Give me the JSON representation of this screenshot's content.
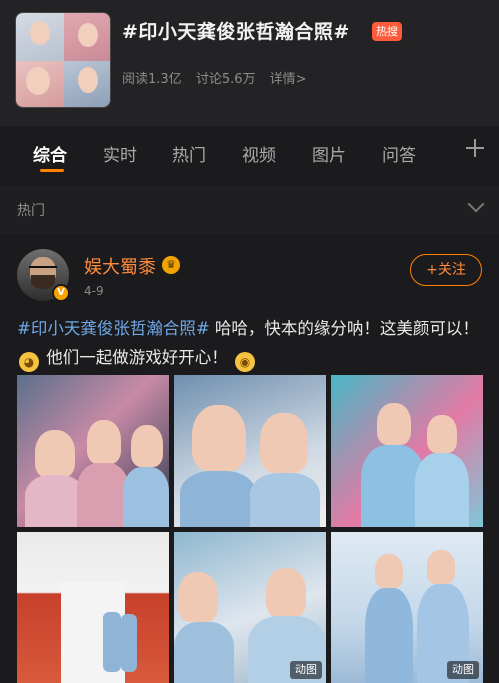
{
  "topic": {
    "title": "#印小天龚俊张哲瀚合照#",
    "badge": "热搜",
    "reads": "阅读1.3亿",
    "discussions": "讨论5.6万",
    "details": "详情>"
  },
  "tabs": [
    {
      "label": "综合",
      "active": true
    },
    {
      "label": "实时",
      "active": false
    },
    {
      "label": "热门",
      "active": false
    },
    {
      "label": "视频",
      "active": false
    },
    {
      "label": "图片",
      "active": false
    },
    {
      "label": "问答",
      "active": false
    }
  ],
  "section": {
    "label": "热门"
  },
  "post": {
    "username": "娱大蜀黍",
    "time": "4-9",
    "follow_label": "+关注",
    "hashtag": "#印小天龚俊张哲瀚合照#",
    "text_part1": "哈哈，快本的缘分呐！这美颜可以！",
    "text_part2": "他们一起做游戏好开心！",
    "gif_label_1": "动图",
    "gif_label_2": "动图"
  },
  "colors": {
    "accent": "#ff8200",
    "hashtag": "#6fa8e8",
    "username": "#ff8a3d",
    "hot_badge": "#ff5b3a",
    "background": "#1b1b1d"
  }
}
